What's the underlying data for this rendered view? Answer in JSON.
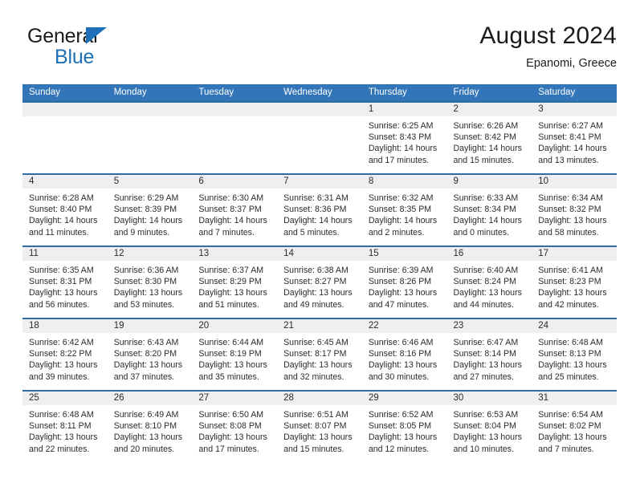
{
  "brand": {
    "name_top": "General",
    "name_bottom": "Blue",
    "triangle_color": "#1d6fb8",
    "text_color": "#1b1b1b"
  },
  "header": {
    "title": "August 2024",
    "subtitle": "Epanomi, Greece"
  },
  "theme": {
    "header_row_bg": "#3275b8",
    "row_rule": "#2e6da4",
    "day_band_bg": "#efefef",
    "text": "#2b2b2b"
  },
  "weekday_headers": [
    "Sunday",
    "Monday",
    "Tuesday",
    "Wednesday",
    "Thursday",
    "Friday",
    "Saturday"
  ],
  "labels": {
    "sunrise_prefix": "Sunrise:",
    "sunset_prefix": "Sunset:",
    "daylight_prefix": "Daylight:"
  },
  "weeks": [
    [
      {
        "day": "",
        "empty": true
      },
      {
        "day": "",
        "empty": true
      },
      {
        "day": "",
        "empty": true
      },
      {
        "day": "",
        "empty": true
      },
      {
        "day": "1",
        "sunrise": "Sunrise: 6:25 AM",
        "sunset": "Sunset: 8:43 PM",
        "daylight": "Daylight: 14 hours and 17 minutes."
      },
      {
        "day": "2",
        "sunrise": "Sunrise: 6:26 AM",
        "sunset": "Sunset: 8:42 PM",
        "daylight": "Daylight: 14 hours and 15 minutes."
      },
      {
        "day": "3",
        "sunrise": "Sunrise: 6:27 AM",
        "sunset": "Sunset: 8:41 PM",
        "daylight": "Daylight: 14 hours and 13 minutes."
      }
    ],
    [
      {
        "day": "4",
        "sunrise": "Sunrise: 6:28 AM",
        "sunset": "Sunset: 8:40 PM",
        "daylight": "Daylight: 14 hours and 11 minutes."
      },
      {
        "day": "5",
        "sunrise": "Sunrise: 6:29 AM",
        "sunset": "Sunset: 8:39 PM",
        "daylight": "Daylight: 14 hours and 9 minutes."
      },
      {
        "day": "6",
        "sunrise": "Sunrise: 6:30 AM",
        "sunset": "Sunset: 8:37 PM",
        "daylight": "Daylight: 14 hours and 7 minutes."
      },
      {
        "day": "7",
        "sunrise": "Sunrise: 6:31 AM",
        "sunset": "Sunset: 8:36 PM",
        "daylight": "Daylight: 14 hours and 5 minutes."
      },
      {
        "day": "8",
        "sunrise": "Sunrise: 6:32 AM",
        "sunset": "Sunset: 8:35 PM",
        "daylight": "Daylight: 14 hours and 2 minutes."
      },
      {
        "day": "9",
        "sunrise": "Sunrise: 6:33 AM",
        "sunset": "Sunset: 8:34 PM",
        "daylight": "Daylight: 14 hours and 0 minutes."
      },
      {
        "day": "10",
        "sunrise": "Sunrise: 6:34 AM",
        "sunset": "Sunset: 8:32 PM",
        "daylight": "Daylight: 13 hours and 58 minutes."
      }
    ],
    [
      {
        "day": "11",
        "sunrise": "Sunrise: 6:35 AM",
        "sunset": "Sunset: 8:31 PM",
        "daylight": "Daylight: 13 hours and 56 minutes."
      },
      {
        "day": "12",
        "sunrise": "Sunrise: 6:36 AM",
        "sunset": "Sunset: 8:30 PM",
        "daylight": "Daylight: 13 hours and 53 minutes."
      },
      {
        "day": "13",
        "sunrise": "Sunrise: 6:37 AM",
        "sunset": "Sunset: 8:29 PM",
        "daylight": "Daylight: 13 hours and 51 minutes."
      },
      {
        "day": "14",
        "sunrise": "Sunrise: 6:38 AM",
        "sunset": "Sunset: 8:27 PM",
        "daylight": "Daylight: 13 hours and 49 minutes."
      },
      {
        "day": "15",
        "sunrise": "Sunrise: 6:39 AM",
        "sunset": "Sunset: 8:26 PM",
        "daylight": "Daylight: 13 hours and 47 minutes."
      },
      {
        "day": "16",
        "sunrise": "Sunrise: 6:40 AM",
        "sunset": "Sunset: 8:24 PM",
        "daylight": "Daylight: 13 hours and 44 minutes."
      },
      {
        "day": "17",
        "sunrise": "Sunrise: 6:41 AM",
        "sunset": "Sunset: 8:23 PM",
        "daylight": "Daylight: 13 hours and 42 minutes."
      }
    ],
    [
      {
        "day": "18",
        "sunrise": "Sunrise: 6:42 AM",
        "sunset": "Sunset: 8:22 PM",
        "daylight": "Daylight: 13 hours and 39 minutes."
      },
      {
        "day": "19",
        "sunrise": "Sunrise: 6:43 AM",
        "sunset": "Sunset: 8:20 PM",
        "daylight": "Daylight: 13 hours and 37 minutes."
      },
      {
        "day": "20",
        "sunrise": "Sunrise: 6:44 AM",
        "sunset": "Sunset: 8:19 PM",
        "daylight": "Daylight: 13 hours and 35 minutes."
      },
      {
        "day": "21",
        "sunrise": "Sunrise: 6:45 AM",
        "sunset": "Sunset: 8:17 PM",
        "daylight": "Daylight: 13 hours and 32 minutes."
      },
      {
        "day": "22",
        "sunrise": "Sunrise: 6:46 AM",
        "sunset": "Sunset: 8:16 PM",
        "daylight": "Daylight: 13 hours and 30 minutes."
      },
      {
        "day": "23",
        "sunrise": "Sunrise: 6:47 AM",
        "sunset": "Sunset: 8:14 PM",
        "daylight": "Daylight: 13 hours and 27 minutes."
      },
      {
        "day": "24",
        "sunrise": "Sunrise: 6:48 AM",
        "sunset": "Sunset: 8:13 PM",
        "daylight": "Daylight: 13 hours and 25 minutes."
      }
    ],
    [
      {
        "day": "25",
        "sunrise": "Sunrise: 6:48 AM",
        "sunset": "Sunset: 8:11 PM",
        "daylight": "Daylight: 13 hours and 22 minutes."
      },
      {
        "day": "26",
        "sunrise": "Sunrise: 6:49 AM",
        "sunset": "Sunset: 8:10 PM",
        "daylight": "Daylight: 13 hours and 20 minutes."
      },
      {
        "day": "27",
        "sunrise": "Sunrise: 6:50 AM",
        "sunset": "Sunset: 8:08 PM",
        "daylight": "Daylight: 13 hours and 17 minutes."
      },
      {
        "day": "28",
        "sunrise": "Sunrise: 6:51 AM",
        "sunset": "Sunset: 8:07 PM",
        "daylight": "Daylight: 13 hours and 15 minutes."
      },
      {
        "day": "29",
        "sunrise": "Sunrise: 6:52 AM",
        "sunset": "Sunset: 8:05 PM",
        "daylight": "Daylight: 13 hours and 12 minutes."
      },
      {
        "day": "30",
        "sunrise": "Sunrise: 6:53 AM",
        "sunset": "Sunset: 8:04 PM",
        "daylight": "Daylight: 13 hours and 10 minutes."
      },
      {
        "day": "31",
        "sunrise": "Sunrise: 6:54 AM",
        "sunset": "Sunset: 8:02 PM",
        "daylight": "Daylight: 13 hours and 7 minutes."
      }
    ]
  ]
}
